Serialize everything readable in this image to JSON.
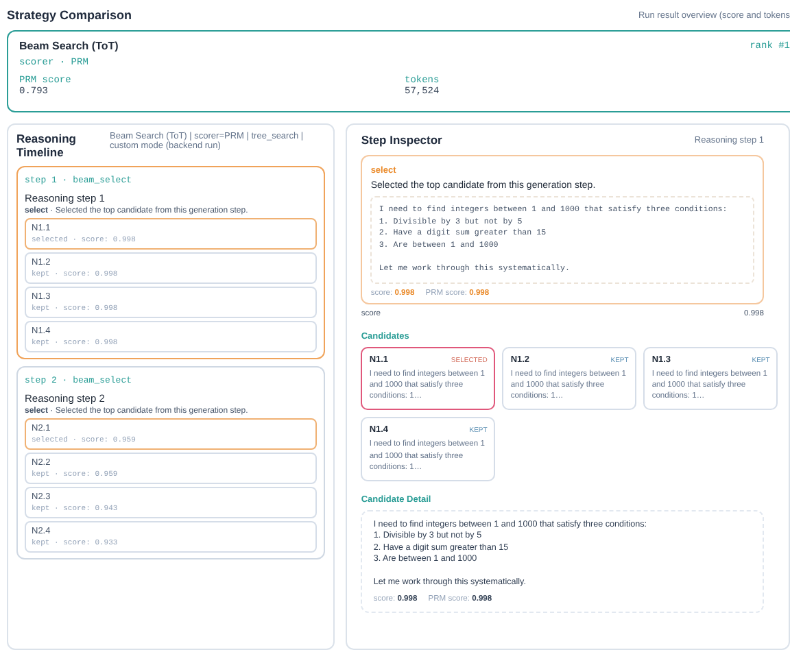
{
  "header": {
    "title": "Strategy Comparison",
    "subtitle": "Run result overview (score and tokens"
  },
  "summary": {
    "name": "Beam Search (ToT)",
    "rank": "rank #1",
    "scorer": "scorer · PRM",
    "metrics": [
      {
        "label": "PRM score",
        "value": "0.793"
      },
      {
        "label": "tokens",
        "value": "57,524"
      }
    ]
  },
  "timeline": {
    "title": "Reasoning Timeline",
    "meta": "Beam Search (ToT) | scorer=PRM | tree_search | custom mode (backend run)",
    "steps": [
      {
        "tag": "step 1 · beam_select",
        "title": "Reasoning step 1",
        "action": "select",
        "description": "· Selected the top candidate from this generation step.",
        "selected": true,
        "nodes": [
          {
            "label": "N1.1",
            "detail": "selected · score: 0.998",
            "selected": true
          },
          {
            "label": "N1.2",
            "detail": "kept · score: 0.998",
            "selected": false
          },
          {
            "label": "N1.3",
            "detail": "kept · score: 0.998",
            "selected": false
          },
          {
            "label": "N1.4",
            "detail": "kept · score: 0.998",
            "selected": false
          }
        ]
      },
      {
        "tag": "step 2 · beam_select",
        "title": "Reasoning step 2",
        "action": "select",
        "description": "· Selected the top candidate from this generation step.",
        "selected": false,
        "nodes": [
          {
            "label": "N2.1",
            "detail": "selected · score: 0.959",
            "selected": true
          },
          {
            "label": "N2.2",
            "detail": "kept · score: 0.959",
            "selected": false
          },
          {
            "label": "N2.3",
            "detail": "kept · score: 0.943",
            "selected": false
          },
          {
            "label": "N2.4",
            "detail": "kept · score: 0.933",
            "selected": false
          }
        ]
      }
    ]
  },
  "inspector": {
    "title": "Step Inspector",
    "step_label": "Reasoning step 1",
    "action": "select",
    "description": "Selected the top candidate from this generation step.",
    "output": "I need to find integers between 1 and 1000 that satisfy three conditions:\n1. Divisible by 3 but not by 5\n2. Have a digit sum greater than 15\n3. Are between 1 and 1000\n\nLet me work through this systematically.",
    "scores": [
      {
        "label": "score:",
        "value": "0.998"
      },
      {
        "label": "PRM score:",
        "value": "0.998"
      }
    ],
    "score_row": {
      "label": "score",
      "value": "0.998"
    },
    "candidates_title": "Candidates",
    "candidates": [
      {
        "label": "N1.1",
        "status": "SELECTED",
        "selected": true,
        "preview": "I need to find integers between 1 and 1000 that satisfy three conditions: 1…"
      },
      {
        "label": "N1.2",
        "status": "KEPT",
        "selected": false,
        "preview": "I need to find integers between 1 and 1000 that satisfy three conditions: 1…"
      },
      {
        "label": "N1.3",
        "status": "KEPT",
        "selected": false,
        "preview": "I need to find integers between 1 and 1000 that satisfy three conditions: 1…"
      },
      {
        "label": "N1.4",
        "status": "KEPT",
        "selected": false,
        "preview": "I need to find integers between 1 and 1000 that satisfy three conditions: 1…"
      }
    ],
    "detail_title": "Candidate Detail",
    "detail_text": "I need to find integers between 1 and 1000 that satisfy three conditions:\n1. Divisible by 3 but not by 5\n2. Have a digit sum greater than 15\n3. Are between 1 and 1000\n\nLet me work through this systematically.",
    "detail_scores": [
      {
        "label": "score:",
        "value": "0.998"
      },
      {
        "label": "PRM score:",
        "value": "0.998"
      }
    ]
  }
}
